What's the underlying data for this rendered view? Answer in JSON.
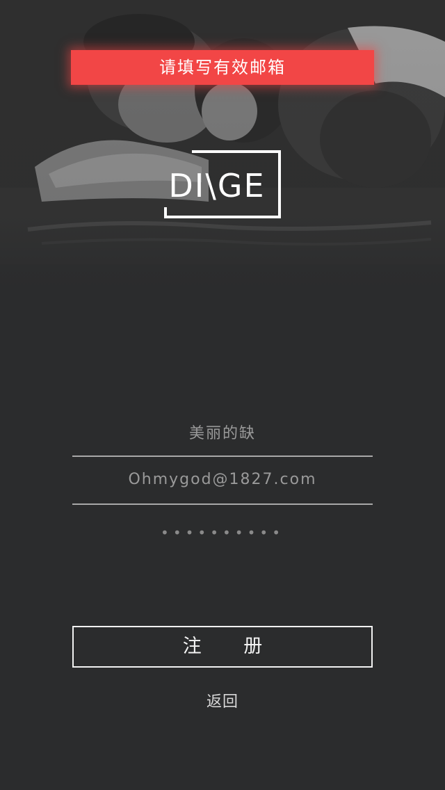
{
  "error_banner": {
    "text": "请填写有效邮箱",
    "color": "#f24646"
  },
  "logo": {
    "text": "DI\\GE"
  },
  "form": {
    "nickname_value": "美丽的缺",
    "email_value": "Ohmygod@1827.com",
    "password_masked": "••••••••••"
  },
  "actions": {
    "register_label": "注 册",
    "back_label": "返回"
  },
  "colors": {
    "background": "#2b2c2d",
    "field_text": "#9a9a9a",
    "divider": "#a9a9a9"
  }
}
